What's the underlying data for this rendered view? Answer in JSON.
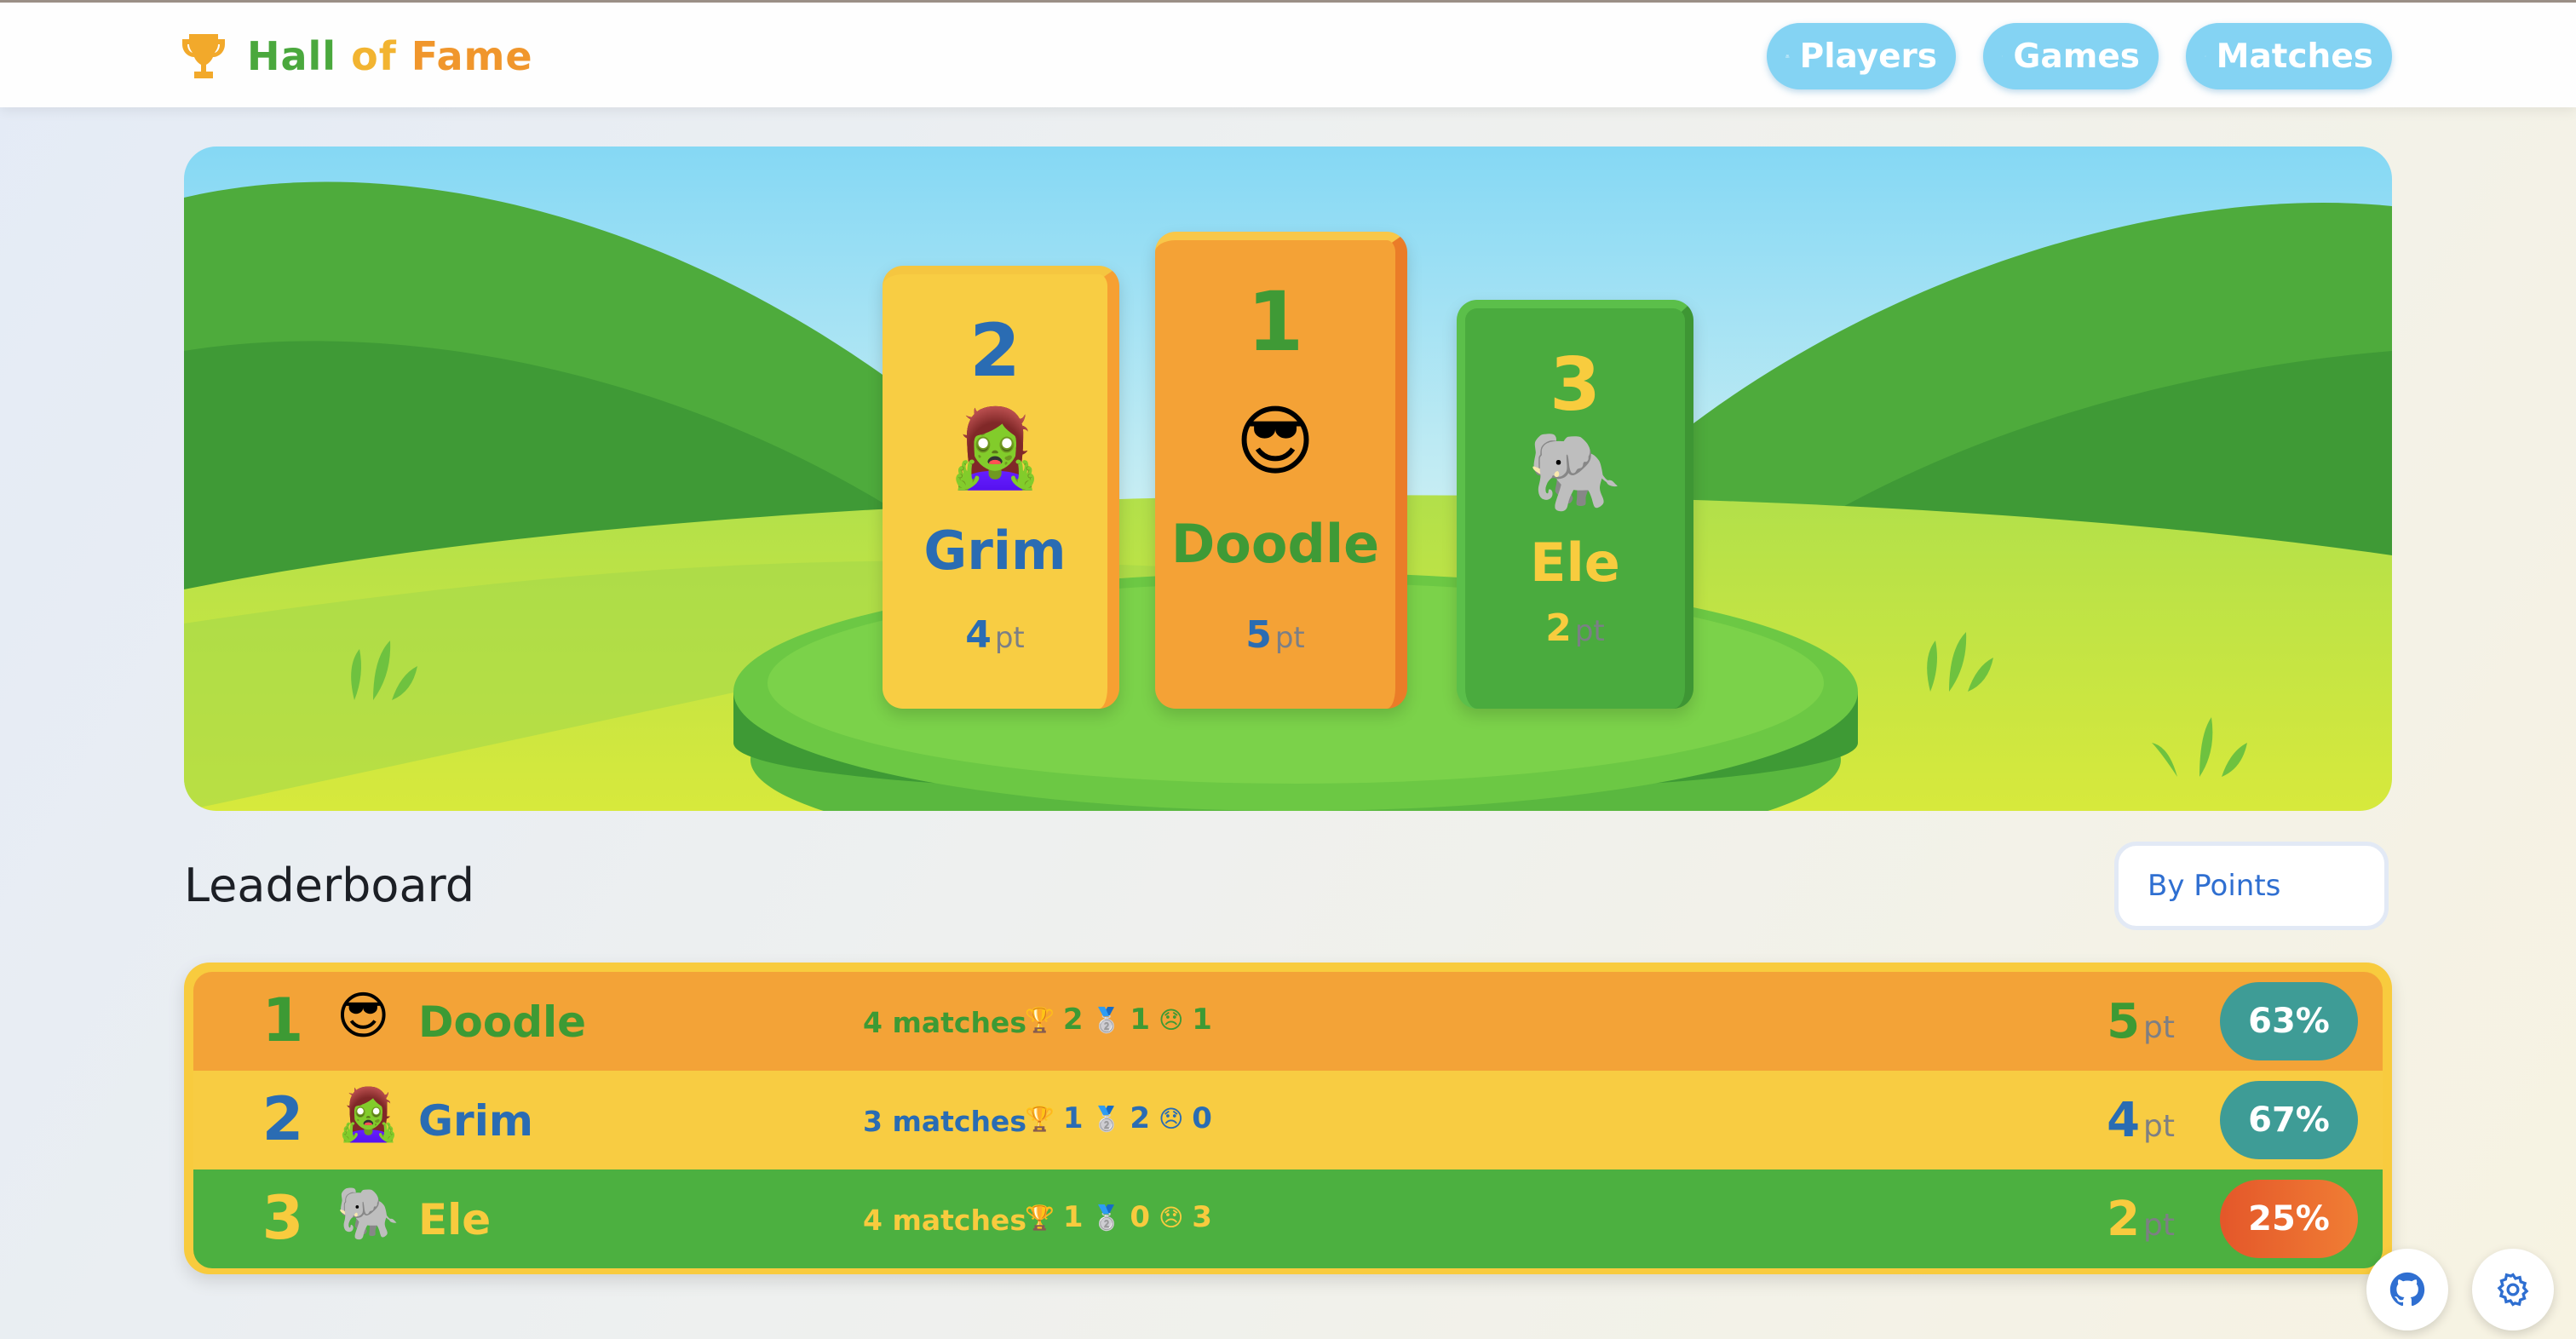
{
  "header": {
    "title_parts": [
      "Hall",
      "of",
      "Fame"
    ],
    "nav": [
      {
        "label": "Players",
        "icon": "users-icon"
      },
      {
        "label": "Games",
        "icon": "gamepad-icon"
      },
      {
        "label": "Matches",
        "icon": "list-icon"
      }
    ]
  },
  "podium": [
    {
      "rank": "2",
      "avatar": "🧟‍♀️",
      "name": "Grim",
      "points": "4",
      "unit": "pt"
    },
    {
      "rank": "1",
      "avatar": "😎",
      "name": "Doodle",
      "points": "5",
      "unit": "pt"
    },
    {
      "rank": "3",
      "avatar": "🐘",
      "name": "Ele",
      "points": "2",
      "unit": "pt"
    }
  ],
  "leaderboard": {
    "title": "Leaderboard",
    "sort_label": "By Points",
    "rows": [
      {
        "rank": "1",
        "avatar": "😎",
        "name": "Doodle",
        "matches": "4 matches",
        "wins": "2",
        "seconds": "1",
        "losses": "1",
        "points": "5",
        "unit": "pt",
        "rate": "63%"
      },
      {
        "rank": "2",
        "avatar": "🧟‍♀️",
        "name": "Grim",
        "matches": "3 matches",
        "wins": "1",
        "seconds": "2",
        "losses": "0",
        "points": "4",
        "unit": "pt",
        "rate": "67%"
      },
      {
        "rank": "3",
        "avatar": "🐘",
        "name": "Ele",
        "matches": "4 matches",
        "wins": "1",
        "seconds": "0",
        "losses": "3",
        "points": "2",
        "unit": "pt",
        "rate": "25%"
      }
    ]
  },
  "icons": {
    "win": "🏆",
    "second": "🥈",
    "loss": "😞"
  },
  "colors": {
    "green": "#4aab3e",
    "orange": "#f4a236",
    "yellow": "#f8cc42",
    "blue": "#2a6cb3",
    "teal_rate": "#3e9c96",
    "red_rate": "#ea5a2a",
    "nav": "#84d3f3"
  }
}
